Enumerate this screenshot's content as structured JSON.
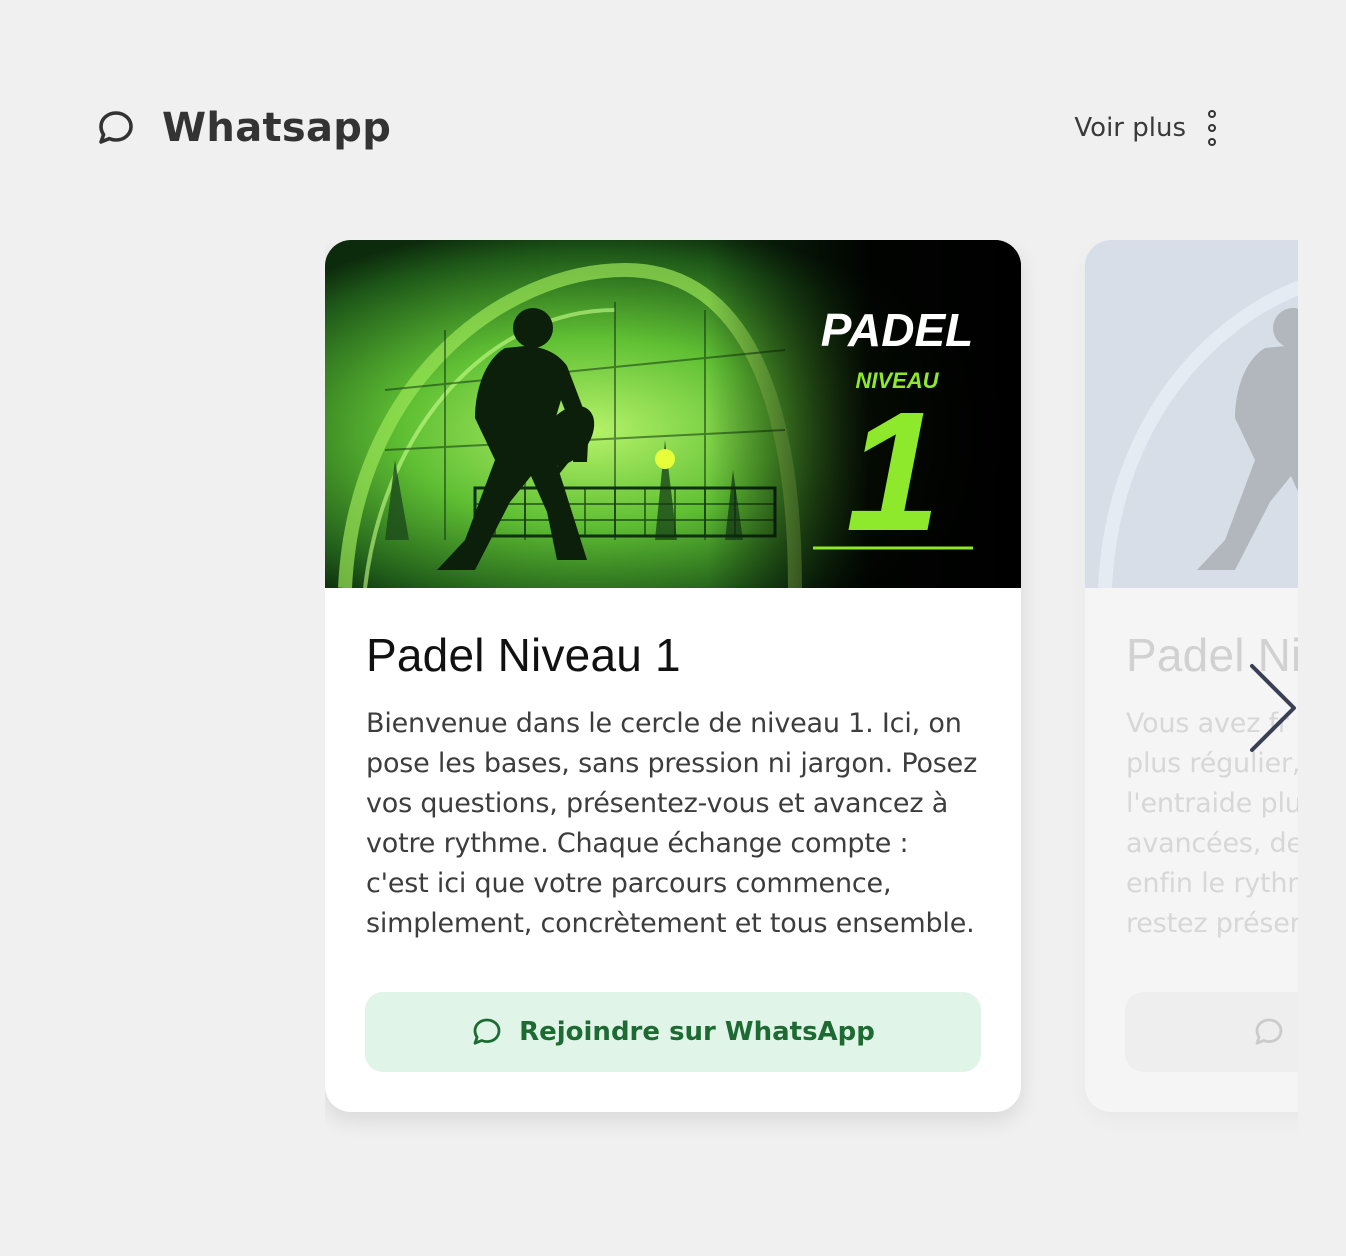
{
  "section": {
    "title": "Whatsapp",
    "more_label": "Voir plus"
  },
  "cards": [
    {
      "banner": {
        "headline": "PADEL",
        "subhead": "NIVEAU",
        "number": "1"
      },
      "title": "Padel Niveau 1",
      "description": [
        "Bienvenue dans le cercle de niveau 1. Ici, on",
        "pose les bases, sans pression ni jargon. Posez",
        "vos questions, présentez-vous et avancez à",
        "votre rythme. Chaque échange compte :",
        "c'est ici que votre parcours commence,",
        "simplement, concrètement et tous ensemble."
      ],
      "button_label": "Rejoindre sur WhatsApp"
    },
    {
      "title": "Padel Ni",
      "description": [
        "Vous avez fr",
        "plus régulier,",
        "l'entraide plu",
        "avancées, de",
        "enfin le rythr",
        "restez préser"
      ]
    }
  ],
  "colors": {
    "accent_green": "#1d6b33",
    "button_bg": "#e1f4e8",
    "banner_green": "#8ee82b"
  },
  "icons": {
    "section": "chat-bubble-icon",
    "more": "kebab-menu-icon",
    "button": "chat-bubble-icon",
    "carousel_next": "chevron-right-icon"
  }
}
